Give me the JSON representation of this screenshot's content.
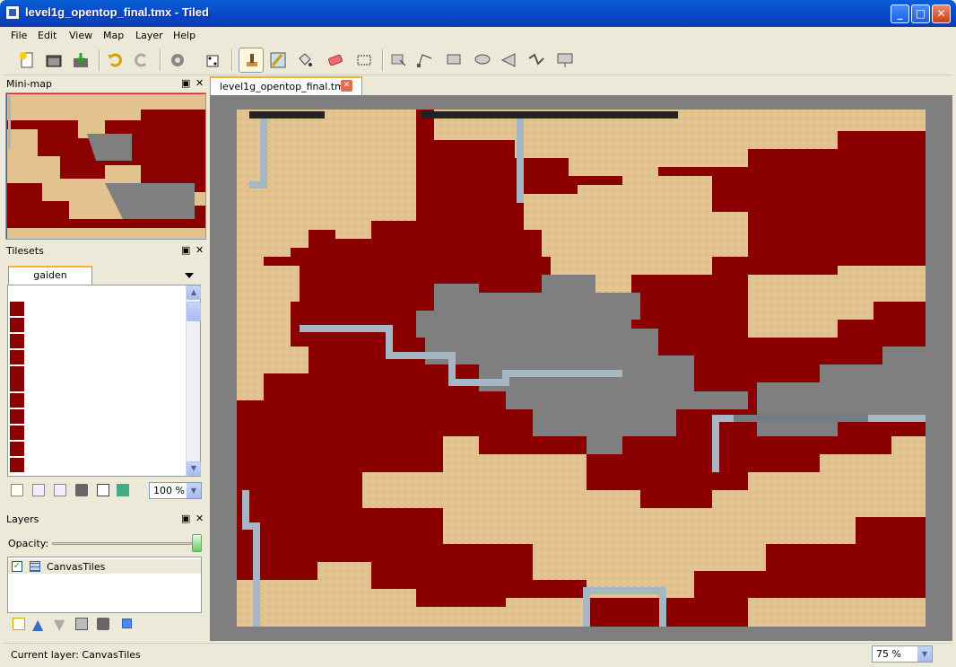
{
  "window": {
    "title": "level1g_opentop_final.tmx - Tiled",
    "min_label": "_",
    "max_label": "□",
    "close_label": "✕"
  },
  "menu": [
    "File",
    "Edit",
    "View",
    "Map",
    "Layer",
    "Help"
  ],
  "toolbar": {
    "icons": [
      "new-map-icon",
      "open-icon",
      "save-icon",
      "undo-icon",
      "redo-icon",
      "commands-icon",
      "random-mode-icon",
      "stamp-brush-icon",
      "terrain-brush-icon",
      "bucket-fill-icon",
      "eraser-icon",
      "rect-select-icon",
      "select-objects-icon",
      "edit-polygons-icon",
      "insert-rectangle-icon",
      "insert-ellipse-icon",
      "insert-polygon-icon",
      "insert-polyline-icon",
      "insert-tile-icon"
    ]
  },
  "minimap": {
    "title": "Mini-map"
  },
  "tilesets": {
    "title": "Tilesets",
    "tab": "gaiden",
    "zoom": "100 %"
  },
  "layers": {
    "title": "Layers",
    "opacity_label": "Opacity:",
    "opacity": 1.0,
    "items": [
      {
        "name": "CanvasTiles",
        "visible": true
      }
    ]
  },
  "document": {
    "tab_label": "level1g_opentop_final.tmx"
  },
  "status": {
    "current_layer": "Current layer: CanvasTiles",
    "zoom": "75 %"
  },
  "colors": {
    "sand": "#e2c28f",
    "rock": "#8b0000",
    "pipe": "#a6b7c4",
    "bg": "#7f7f7f",
    "lava": "#ff2a1a"
  }
}
